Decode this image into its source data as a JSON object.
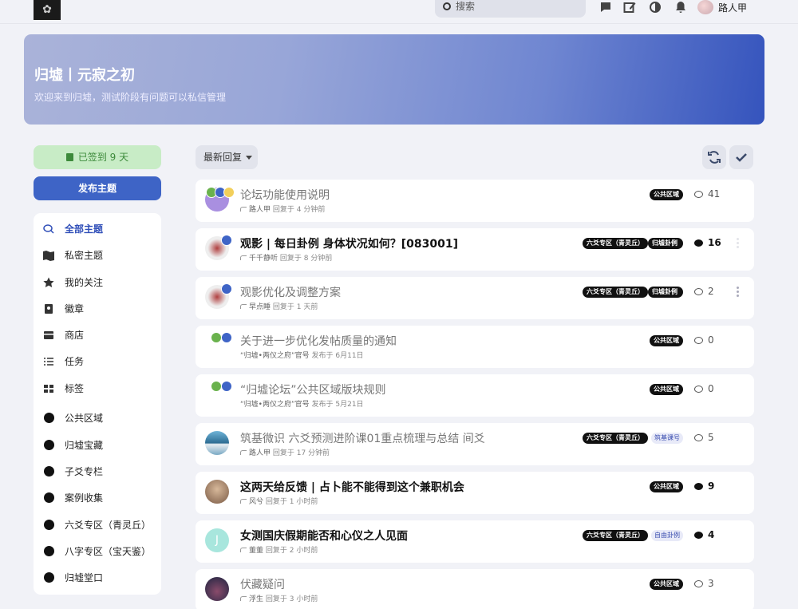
{
  "header": {
    "search_label": "搜索",
    "username": "路人甲"
  },
  "hero": {
    "title": "归墟丨元寂之初",
    "subtitle": "欢迎来到归墟，测试阶段有问题可以私信管理"
  },
  "sidebar": {
    "checkin_label": "已签到 9 天",
    "post_button": "发布主题",
    "nav": [
      {
        "label": "全部主题",
        "icon": "discussions-icon"
      },
      {
        "label": "私密主题",
        "icon": "map-icon"
      },
      {
        "label": "我的关注",
        "icon": "star-icon"
      },
      {
        "label": "徽章",
        "icon": "badge-icon"
      },
      {
        "label": "商店",
        "icon": "store-icon"
      },
      {
        "label": "任务",
        "icon": "task-list-icon"
      },
      {
        "label": "标签",
        "icon": "tags-grid-icon"
      }
    ],
    "tags": [
      "公共区域",
      "归墟宝藏",
      "子爻专栏",
      "案例收集",
      "六爻专区（青灵丘）",
      "八字专区（宝天鉴）",
      "归墟堂口"
    ]
  },
  "toolbar": {
    "sort_label": "最新回复",
    "refresh_icon": "refresh-icon",
    "mark_read_icon": "check-icon"
  },
  "topics": [
    {
      "title": "论坛功能使用说明",
      "user": "路人甲",
      "action": "回复于 4 分钟前",
      "tags": [
        "公共区域"
      ],
      "replies": "41",
      "bold": false
    },
    {
      "title": "观影 | 每日卦例 身体状况如何？[083001]",
      "user": "千千静听",
      "action": "回复于 8 分钟前",
      "tags": [
        "六爻专区（青灵丘）",
        "归墟卦例"
      ],
      "replies": "16",
      "bold": true
    },
    {
      "title": "观影优化及调整方案",
      "user": "早点睡",
      "action": "回复于 1 天前",
      "tags": [
        "六爻专区（青灵丘）",
        "归墟卦例"
      ],
      "replies": "2",
      "bold": false
    },
    {
      "title": "关于进一步优化发帖质量的通知",
      "user": "“归墟•两仪之府”官号",
      "action": "发布于 6月11日",
      "tags": [
        "公共区域"
      ],
      "replies": "0",
      "bold": false
    },
    {
      "title": "“归墟论坛”公共区域版块规则",
      "user": "“归墟•两仪之府”官号",
      "action": "发布于 5月21日",
      "tags": [
        "公共区域"
      ],
      "replies": "0",
      "bold": false
    },
    {
      "title": "筑基微识 六爻预测进阶课01重点梳理与总结 间爻",
      "user": "路人甲",
      "action": "回复于 17 分钟前",
      "tags": [
        "六爻专区（青灵丘）",
        "筑基课号"
      ],
      "replies": "5",
      "bold": false
    },
    {
      "title": "这两天给反馈 | 占卜能不能得到这个兼职机会",
      "user": "风兮",
      "action": "回复于 1 小时前",
      "tags": [
        "公共区域"
      ],
      "replies": "9",
      "bold": true
    },
    {
      "title": "女测国庆假期能否和心仪之人见面",
      "user": "董董",
      "action": "回复于 2 小时前",
      "tags": [
        "六爻专区（青灵丘）",
        "自由卦例"
      ],
      "replies": "4",
      "bold": true
    },
    {
      "title": "伏藏疑问",
      "user": "浮生",
      "action": "回复于 3 小时前",
      "tags": [
        "公共区域"
      ],
      "replies": "3",
      "bold": false
    }
  ],
  "avatar_letter": "J"
}
